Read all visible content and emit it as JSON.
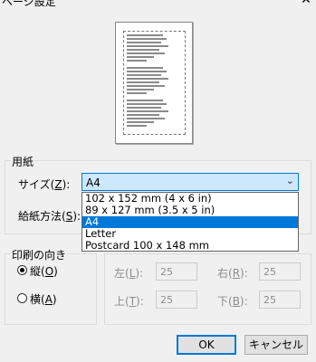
{
  "window": {
    "title": "ページ設定",
    "close_glyph": "✕"
  },
  "paper_group": {
    "legend": "用紙",
    "size_label": "サイズ(",
    "size_mnemonic": "Z",
    "size_label_end": "):",
    "size_value": "A4",
    "size_options": [
      "102 x 152 mm (4 x 6 in)",
      "89 x 127 mm (3.5 x 5 in)",
      "A4",
      "Letter",
      "Postcard 100 x 148 mm"
    ],
    "source_label": "給紙方法(",
    "source_mnemonic": "S",
    "source_label_end": "):"
  },
  "orientation_group": {
    "legend": "印刷の向き",
    "portrait_label": "縦(",
    "portrait_mnemonic": "O",
    "portrait_label_end": ")",
    "landscape_label": "横(",
    "landscape_mnemonic": "A",
    "landscape_label_end": ")",
    "selected": "portrait"
  },
  "margins": {
    "left_label": "左(",
    "left_mn": "L",
    "left_end": "):",
    "left_value": "25",
    "right_label": "右(",
    "right_mn": "R",
    "right_end": "):",
    "right_value": "25",
    "top_label": "上(",
    "top_mn": "T",
    "top_end": "):",
    "top_value": "25",
    "bottom_label": "下(",
    "bottom_mn": "B",
    "bottom_end": "):",
    "bottom_value": "25"
  },
  "buttons": {
    "ok": "OK",
    "cancel": "キャンセル"
  },
  "colors": {
    "accent": "#0078d7",
    "combo_bg": "#cce8ff"
  }
}
